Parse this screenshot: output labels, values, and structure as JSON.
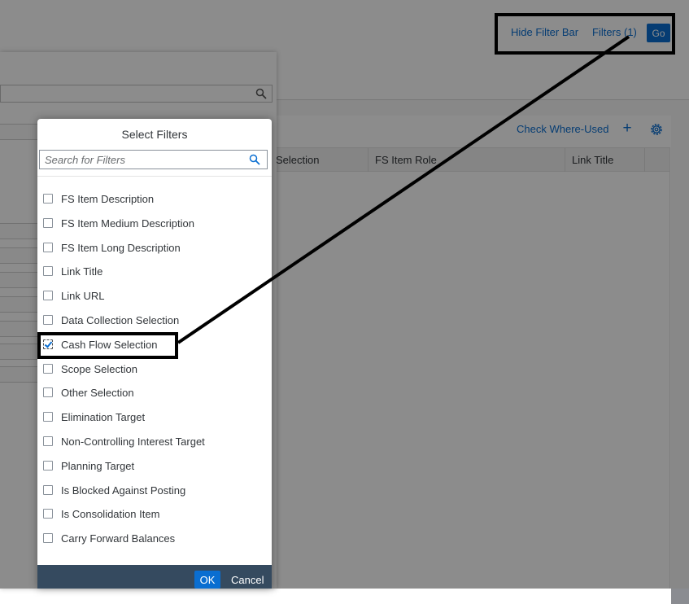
{
  "header": {
    "hide_filter_bar": "Hide Filter Bar",
    "filters": "Filters (1)",
    "go": "Go"
  },
  "toolbar": {
    "check_where_used": "Check Where-Used",
    "add_icon": "plus-icon",
    "settings_icon": "gear-icon"
  },
  "table": {
    "columns": [
      "Selection",
      "FS Item Role",
      "Link Title"
    ]
  },
  "dialog": {
    "title": "Select Filters",
    "search_placeholder": "Search for Filters",
    "items": [
      {
        "label": "FS Item Description",
        "checked": false
      },
      {
        "label": "FS Item Medium Description",
        "checked": false
      },
      {
        "label": "FS Item Long Description",
        "checked": false
      },
      {
        "label": "Link Title",
        "checked": false
      },
      {
        "label": "Link URL",
        "checked": false
      },
      {
        "label": "Data Collection Selection",
        "checked": false
      },
      {
        "label": "Cash Flow Selection",
        "checked": true
      },
      {
        "label": "Scope Selection",
        "checked": false
      },
      {
        "label": "Other Selection",
        "checked": false
      },
      {
        "label": "Elimination Target",
        "checked": false
      },
      {
        "label": "Non-Controlling Interest Target",
        "checked": false
      },
      {
        "label": "Planning Target",
        "checked": false
      },
      {
        "label": "Is Blocked Against Posting",
        "checked": false
      },
      {
        "label": "Is Consolidation Item",
        "checked": false
      },
      {
        "label": "Carry Forward Balances",
        "checked": false
      }
    ],
    "ok": "OK",
    "cancel": "Cancel"
  },
  "colors": {
    "accent": "#0a6ed1",
    "footer": "#354a5f",
    "annotation": "#000000"
  }
}
